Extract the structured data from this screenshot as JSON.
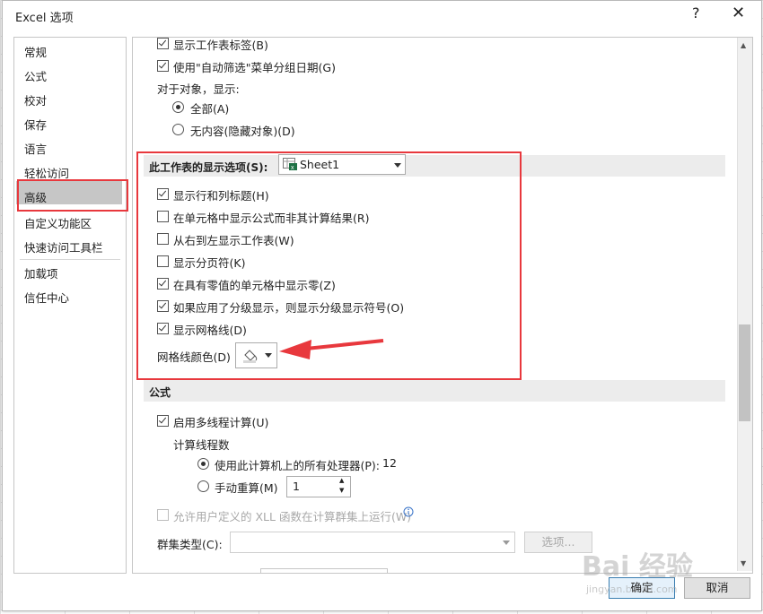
{
  "dialog": {
    "title": "Excel 选项",
    "help": "?",
    "close": "✕"
  },
  "nav": {
    "items": [
      {
        "label": "常规"
      },
      {
        "label": "公式"
      },
      {
        "label": "校对"
      },
      {
        "label": "保存"
      },
      {
        "label": "语言"
      },
      {
        "label": "轻松访问"
      },
      {
        "label": "高级",
        "selected": true
      },
      {
        "label": "自定义功能区"
      },
      {
        "label": "快速访问工具栏"
      },
      {
        "label": "加载项"
      },
      {
        "label": "信任中心"
      }
    ]
  },
  "content": {
    "top": {
      "show_sheet_tabs": "显示工作表标签(B)",
      "group_dates": "使用\"自动筛选\"菜单分组日期(G)",
      "objects_header": "对于对象，显示:",
      "all": "全部(A)",
      "nothing": "无内容(隐藏对象)(D)"
    },
    "sheet_section": {
      "title": "此工作表的显示选项(S):",
      "sheet_value": "Sheet1",
      "sheet_icon": "excel-sheet-icon",
      "options": [
        {
          "label": "显示行和列标题(H)",
          "checked": true
        },
        {
          "label": "在单元格中显示公式而非其计算结果(R)",
          "checked": false
        },
        {
          "label": "从右到左显示工作表(W)",
          "checked": false
        },
        {
          "label": "显示分页符(K)",
          "checked": false
        },
        {
          "label": "在具有零值的单元格中显示零(Z)",
          "checked": true
        },
        {
          "label": "如果应用了分级显示，则显示分级显示符号(O)",
          "checked": true
        },
        {
          "label": "显示网格线(D)",
          "checked": true
        }
      ],
      "gridline_color_label": "网格线颜色(D)",
      "gridline_color_icon": "paint-bucket-icon"
    },
    "formula_section": {
      "title": "公式",
      "multithread": "启用多线程计算(U)",
      "threads_header": "计算线程数",
      "use_all": "使用此计算机上的所有处理器(P):",
      "processor_count": "12",
      "manual": "手动重算(M)",
      "manual_value": "1",
      "xll": "允许用户定义的 XLL 函数在计算群集上运行(W)",
      "cluster_type": "群集类型(C):",
      "options_btn": "选项..."
    }
  },
  "footer": {
    "ok": "确定",
    "cancel": "取消"
  },
  "watermark": {
    "text": "Bai 经验",
    "sub": "jingyan.baidu.com"
  },
  "colors": {
    "highlight": "#e8383d",
    "selected_nav": "#c6c6c6",
    "section_bg": "#ececec"
  }
}
